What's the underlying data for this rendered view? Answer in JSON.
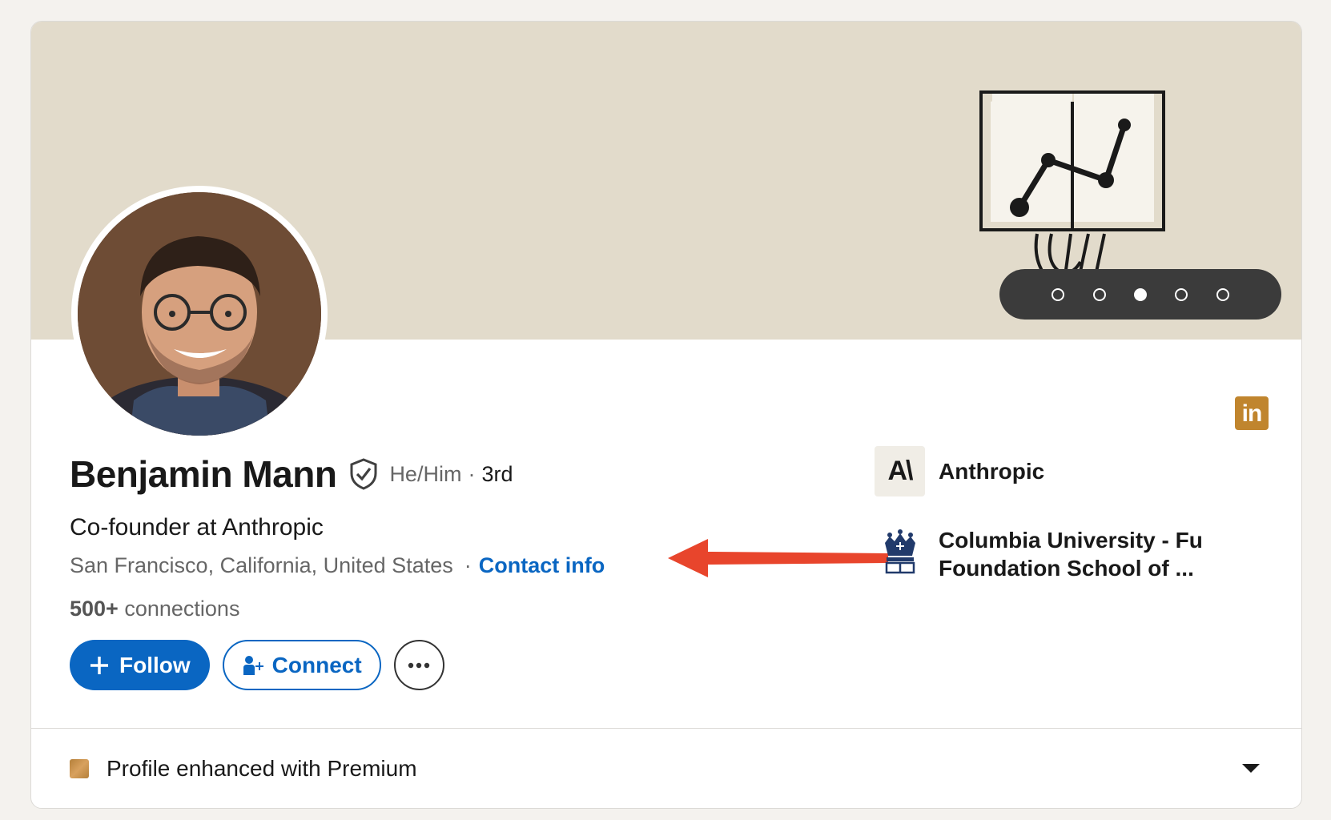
{
  "profile": {
    "name": "Benjamin Mann",
    "pronouns": "He/Him",
    "degree_separator": "·",
    "degree": "3rd",
    "headline": "Co-founder at Anthropic",
    "location": "San Francisco, California, United States",
    "contact_separator": "·",
    "contact_link": "Contact info",
    "connections_count": "500+",
    "connections_label": "connections"
  },
  "actions": {
    "follow_label": "Follow",
    "connect_label": "Connect",
    "more_icon": "ellipsis-icon"
  },
  "experience": {
    "company_logo_text": "A\\",
    "company_name": "Anthropic",
    "school_name": "Columbia University - Fu Foundation School of ..."
  },
  "carousel": {
    "total": 5,
    "active_index": 2
  },
  "premium": {
    "label": "Profile enhanced with Premium"
  },
  "colors": {
    "accent_blue": "#0a66c2",
    "banner_bg": "#e2dbcb",
    "premium_gold": "#c0852e",
    "arrow_red": "#e8452c"
  },
  "badges": {
    "linkedin_badge": "in"
  }
}
